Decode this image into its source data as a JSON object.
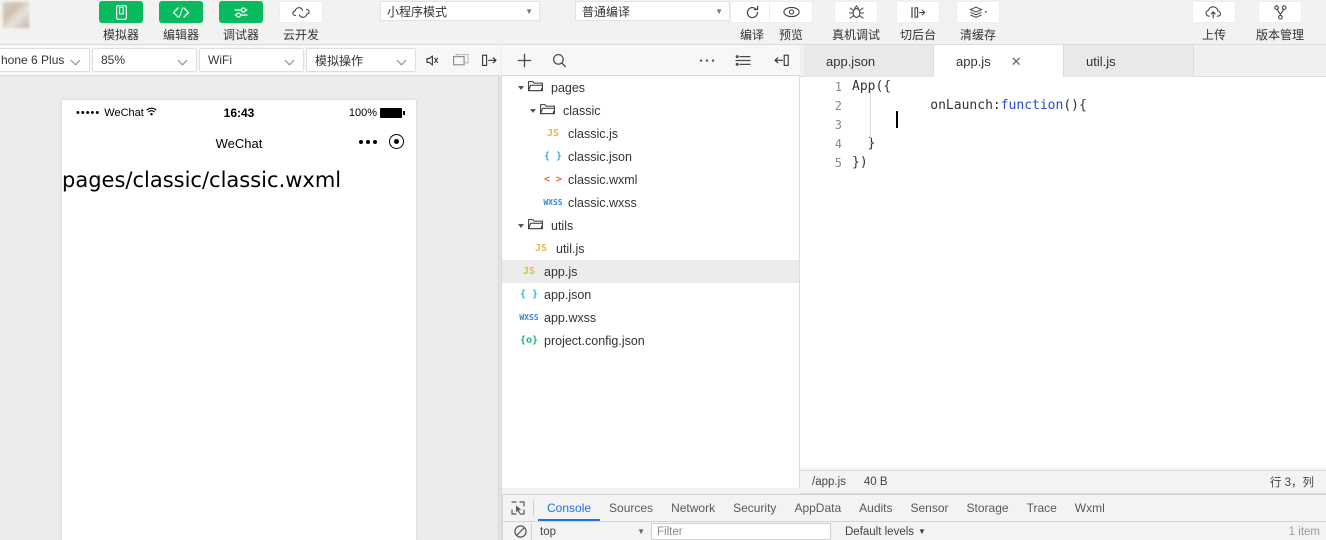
{
  "toolbar": {
    "avatar_alt": "user-avatar",
    "buttons": [
      {
        "icon": "simulator-icon",
        "label": "模拟器",
        "style": "green"
      },
      {
        "icon": "editor-icon",
        "label": "编辑器",
        "style": "green"
      },
      {
        "icon": "debugger-icon",
        "label": "调试器",
        "style": "green"
      },
      {
        "icon": "cloud-dev-icon",
        "label": "云开发",
        "style": "white"
      }
    ],
    "mode_select": "小程序模式",
    "compile_select": "普通编译",
    "actions": [
      {
        "icon": "refresh-icon",
        "label": "编译"
      },
      {
        "icon": "eye-icon",
        "label": "预览"
      },
      {
        "icon": "device-debug-icon",
        "label": "真机调试"
      },
      {
        "icon": "background-icon",
        "label": "切后台"
      },
      {
        "icon": "clear-cache-icon",
        "label": "清缓存"
      }
    ],
    "right_actions": [
      {
        "icon": "upload-icon",
        "label": "上传"
      },
      {
        "icon": "version-icon",
        "label": "版本管理"
      }
    ]
  },
  "simbar": {
    "device": "hone 6 Plus",
    "zoom": "85%",
    "network": "WiFi",
    "operation": "模拟操作",
    "icons": [
      "mute-icon",
      "window-icon",
      "collapse-panel-icon"
    ]
  },
  "filetoolbar": {
    "icons": [
      "add-file-icon",
      "search-icon",
      "more-icon",
      "outline-icon",
      "collapse-left-icon"
    ]
  },
  "tabs": [
    {
      "label": "app.json",
      "active": false,
      "closable": false
    },
    {
      "label": "app.js",
      "active": true,
      "closable": true
    },
    {
      "label": "util.js",
      "active": false,
      "closable": false
    }
  ],
  "tab_close_glyph": "✕",
  "simulator": {
    "status": {
      "signal_dots": "•••••",
      "carrier": "WeChat",
      "wifi_icon": "wifi-icon",
      "time": "16:43",
      "battery_percent": "100%"
    },
    "nav_title": "WeChat",
    "capsule": {
      "more_icon": "more-dots-icon",
      "target_icon": "target-circle-icon"
    },
    "body_text": "pages/classic/classic.wxml"
  },
  "filetree": [
    {
      "name": "pages",
      "type": "folder",
      "depth": 0,
      "expanded": true,
      "selected": false
    },
    {
      "name": "classic",
      "type": "folder",
      "depth": 1,
      "expanded": true,
      "selected": false
    },
    {
      "name": "classic.js",
      "type": "js",
      "depth": 2,
      "icon": "JS",
      "selected": false
    },
    {
      "name": "classic.json",
      "type": "json",
      "depth": 2,
      "icon": "{ }",
      "selected": false
    },
    {
      "name": "classic.wxml",
      "type": "wxml",
      "depth": 2,
      "icon": "< >",
      "selected": false
    },
    {
      "name": "classic.wxss",
      "type": "wxss",
      "depth": 2,
      "icon": "WXSS",
      "selected": false
    },
    {
      "name": "utils",
      "type": "folder",
      "depth": 0,
      "expanded": true,
      "selected": false
    },
    {
      "name": "util.js",
      "type": "js",
      "depth": 1,
      "icon": "JS",
      "selected": false
    },
    {
      "name": "app.js",
      "type": "js",
      "depth": 0,
      "icon": "JS",
      "selected": true
    },
    {
      "name": "app.json",
      "type": "json",
      "depth": 0,
      "icon": "{ }",
      "selected": false
    },
    {
      "name": "app.wxss",
      "type": "wxss",
      "depth": 0,
      "icon": "WXSS",
      "selected": false
    },
    {
      "name": "project.config.json",
      "type": "cfg",
      "depth": 0,
      "icon": "{o}",
      "selected": false
    }
  ],
  "code": {
    "lines": [
      {
        "n": "1",
        "parts": [
          {
            "t": "App({",
            "c": "plain"
          }
        ]
      },
      {
        "n": "2",
        "parts": [
          {
            "t": "  onLaunch:",
            "c": "plain"
          },
          {
            "t": "function",
            "c": "kw"
          },
          {
            "t": "(){",
            "c": "plain"
          }
        ]
      },
      {
        "n": "3",
        "parts": [
          {
            "t": "",
            "c": "plain"
          }
        ]
      },
      {
        "n": "4",
        "parts": [
          {
            "t": "  }",
            "c": "plain"
          }
        ]
      },
      {
        "n": "5",
        "parts": [
          {
            "t": "})",
            "c": "plain"
          }
        ]
      }
    ]
  },
  "editor_status": {
    "path": "/app.js",
    "size": "40 B",
    "cursor": "行 3，列"
  },
  "devtools": {
    "inspect_icon": "inspect-element-icon",
    "tabs": [
      {
        "label": "Console",
        "active": true
      },
      {
        "label": "Sources",
        "active": false
      },
      {
        "label": "Network",
        "active": false
      },
      {
        "label": "Security",
        "active": false
      },
      {
        "label": "AppData",
        "active": false
      },
      {
        "label": "Audits",
        "active": false
      },
      {
        "label": "Sensor",
        "active": false
      },
      {
        "label": "Storage",
        "active": false
      },
      {
        "label": "Trace",
        "active": false
      },
      {
        "label": "Wxml",
        "active": false
      }
    ],
    "clear_icon": "clear-console-icon",
    "context": "top",
    "filter_placeholder": "Filter",
    "levels": "Default levels",
    "item_count": "1 item"
  },
  "colors": {
    "wechat_green": "#09bb5f",
    "accent_blue": "#1a73e8",
    "keyword_blue": "#2b4ad4",
    "selected_row": "#ececec"
  }
}
